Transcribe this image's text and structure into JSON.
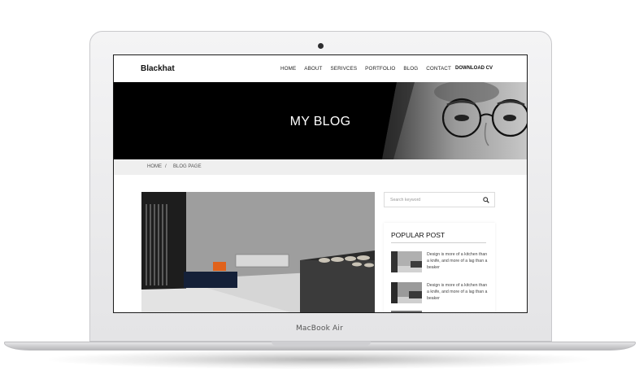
{
  "device": {
    "brand_label": "MacBook Air"
  },
  "site": {
    "logo": "Blackhat",
    "nav": [
      "HOME",
      "ABOUT",
      "SERIVCES",
      "PORTFOLIO",
      "BLOG",
      "CONTACT"
    ],
    "cta": "DOWNLOAD CV"
  },
  "hero": {
    "title": "MY BLOG"
  },
  "breadcrumb": {
    "home": "HOME",
    "separator": "/",
    "current": "BLOG PAGE"
  },
  "sidebar": {
    "search_placeholder": "Search keyword",
    "popular_title": "POPULAR POST",
    "posts": [
      {
        "text": "Design is more of a kitchen than a knife, and more of a lag than a beaker"
      },
      {
        "text": "Design is more of a kitchen than a knife, and more of a lag than a beaker"
      }
    ]
  }
}
